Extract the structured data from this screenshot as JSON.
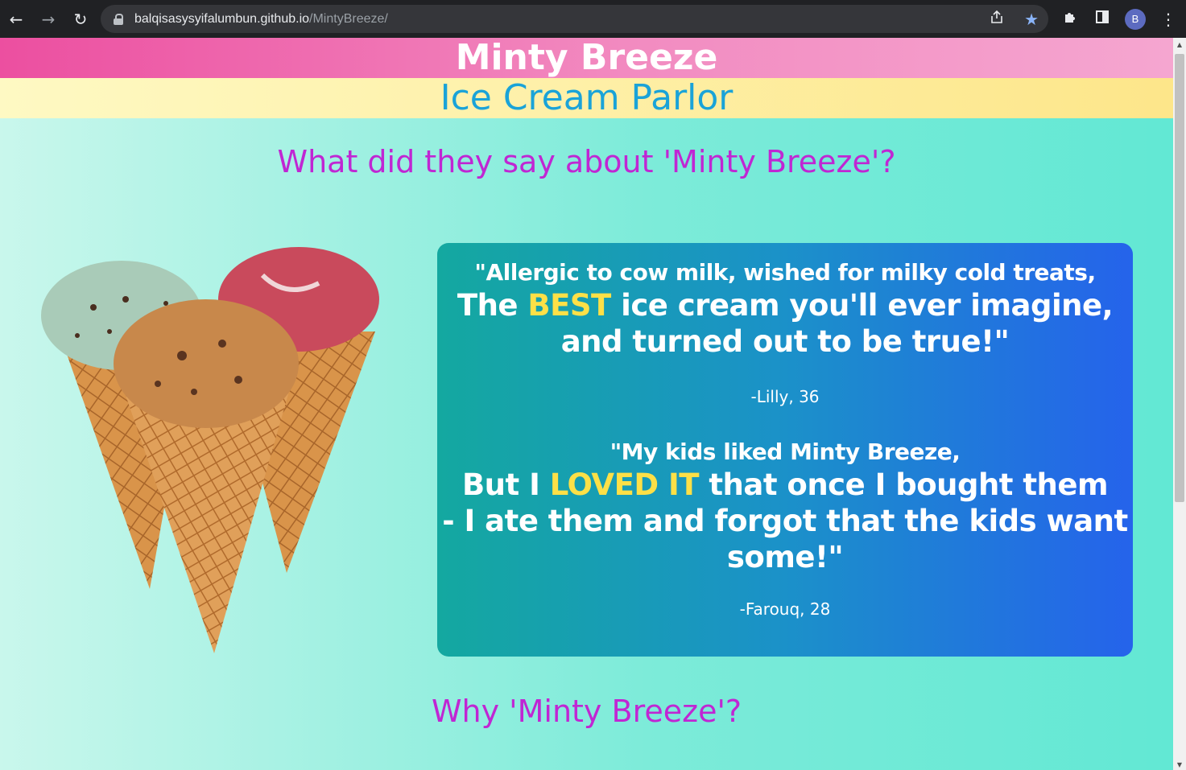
{
  "browser": {
    "url_host": "balqisasysyifalumbun.github.io",
    "url_path": "/MintyBreeze/",
    "profile_initial": "B",
    "icons": [
      "back-icon",
      "forward-icon",
      "reload-icon",
      "lock-icon",
      "share-icon",
      "star-icon",
      "extensions-icon",
      "side-panel-icon",
      "menu-icon"
    ]
  },
  "header": {
    "title": "Minty Breeze",
    "subtitle": "Ice Cream Parlor"
  },
  "testimonials": {
    "heading": "What did they say about 'Minty Breeze'?",
    "items": [
      {
        "line1": "\"Allergic to cow milk, wished for milky cold treats,",
        "line2_before": "The ",
        "line2_highlight": "BEST",
        "line2_after": " ice cream you'll ever imagine,",
        "line3": "and turned out to be true!\"",
        "author": "-Lilly, 36"
      },
      {
        "line1": "\"My kids liked Minty Breeze,",
        "line2_before": "But I ",
        "line2_highlight": "LOVED IT",
        "line2_after": " that once I bought them",
        "line3": "- I ate them and forgot that the kids want",
        "line4": "some!\"",
        "author": "-Farouq, 28"
      }
    ]
  },
  "why": {
    "heading": "Why 'Minty Breeze'?"
  },
  "colors": {
    "accent_pink": "#ec4fa0",
    "heading_magenta": "#c026d3",
    "subtitle_blue": "#1aa3d8",
    "highlight_yellow": "#fde047"
  }
}
